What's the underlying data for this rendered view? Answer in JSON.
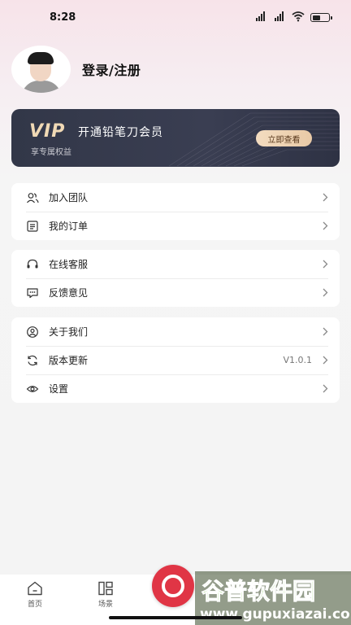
{
  "status_bar": {
    "time": "8:28"
  },
  "profile": {
    "login_label": "登录/注册"
  },
  "vip": {
    "logo": "VIP",
    "title": "开通铅笔刀会员",
    "subtitle": "享专属权益",
    "button": "立即查看",
    "accent": "#f0d9b5"
  },
  "groups": [
    [
      {
        "label": "加入团队",
        "icon": "team-icon"
      },
      {
        "label": "我的订单",
        "icon": "order-icon"
      }
    ],
    [
      {
        "label": "在线客服",
        "icon": "headset-icon"
      },
      {
        "label": "反馈意见",
        "icon": "feedback-icon"
      }
    ],
    [
      {
        "label": "关于我们",
        "icon": "about-icon"
      },
      {
        "label": "版本更新",
        "icon": "refresh-icon",
        "value": "V1.0.1"
      },
      {
        "label": "设置",
        "icon": "eye-icon"
      }
    ]
  ],
  "tabbar": {
    "home": "首页",
    "scene": "场景",
    "record_color": "#e03545"
  },
  "watermark": {
    "brand": "谷普软件园",
    "url": "www.gupuxiazai.com"
  }
}
